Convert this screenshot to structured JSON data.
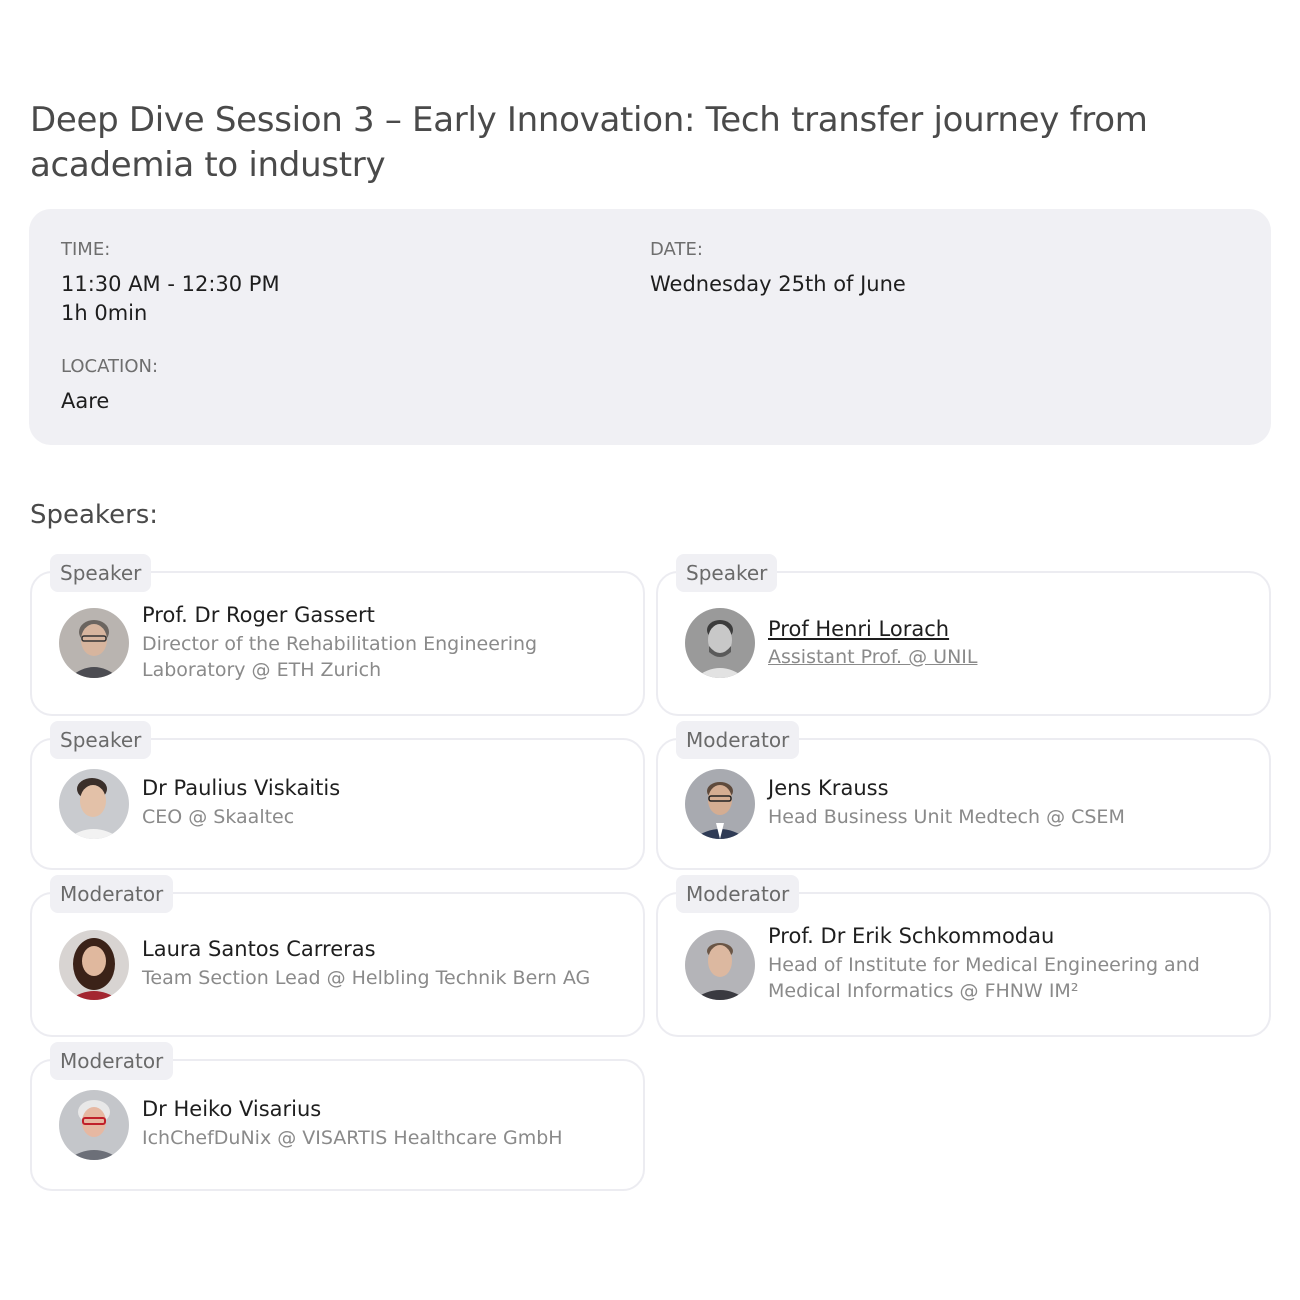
{
  "session": {
    "title": "Deep Dive Session 3 – Early Innovation: Tech transfer journey from academia to industry"
  },
  "info": {
    "time_label": "TIME:",
    "time_range": "11:30 AM - 12:30 PM",
    "duration": "1h 0min",
    "date_label": "DATE:",
    "date_value": "Wednesday 25th of June",
    "location_label": "LOCATION:",
    "location_value": "Aare"
  },
  "speakers_heading": "Speakers:",
  "speakers": [
    {
      "role": "Speaker",
      "name": "Prof. Dr Roger Gassert",
      "title": "Director of the Rehabilitation Engineering Laboratory @ ETH Zurich",
      "avatar": "person-photo-grey-hair-glasses"
    },
    {
      "role": "Speaker",
      "name": "Prof Henri Lorach",
      "title": "Assistant Prof. @ UNIL",
      "avatar": "person-photo-bw-beard"
    },
    {
      "role": "Speaker",
      "name": "Dr Paulius Viskaitis",
      "title": "CEO @ Skaaltec",
      "avatar": "person-photo-dark-hair"
    },
    {
      "role": "Moderator",
      "name": "Jens Krauss",
      "title": "Head Business Unit Medtech @ CSEM",
      "avatar": "person-photo-glasses-suit"
    },
    {
      "role": "Moderator",
      "name": "Laura Santos Carreras",
      "title": "Team Section Lead @ Helbling Technik Bern AG",
      "avatar": "person-photo-long-dark-hair"
    },
    {
      "role": "Moderator",
      "name": "Prof. Dr Erik Schkommodau",
      "title": "Head of Institute for Medical Engineering and Medical Informatics @ FHNW IM²",
      "avatar": "person-photo-short-hair"
    },
    {
      "role": "Moderator",
      "name": "Dr Heiko Visarius",
      "title": "IchChefDuNix @ VISARTIS Healthcare GmbH",
      "avatar": "person-photo-white-hair-glasses"
    }
  ]
}
